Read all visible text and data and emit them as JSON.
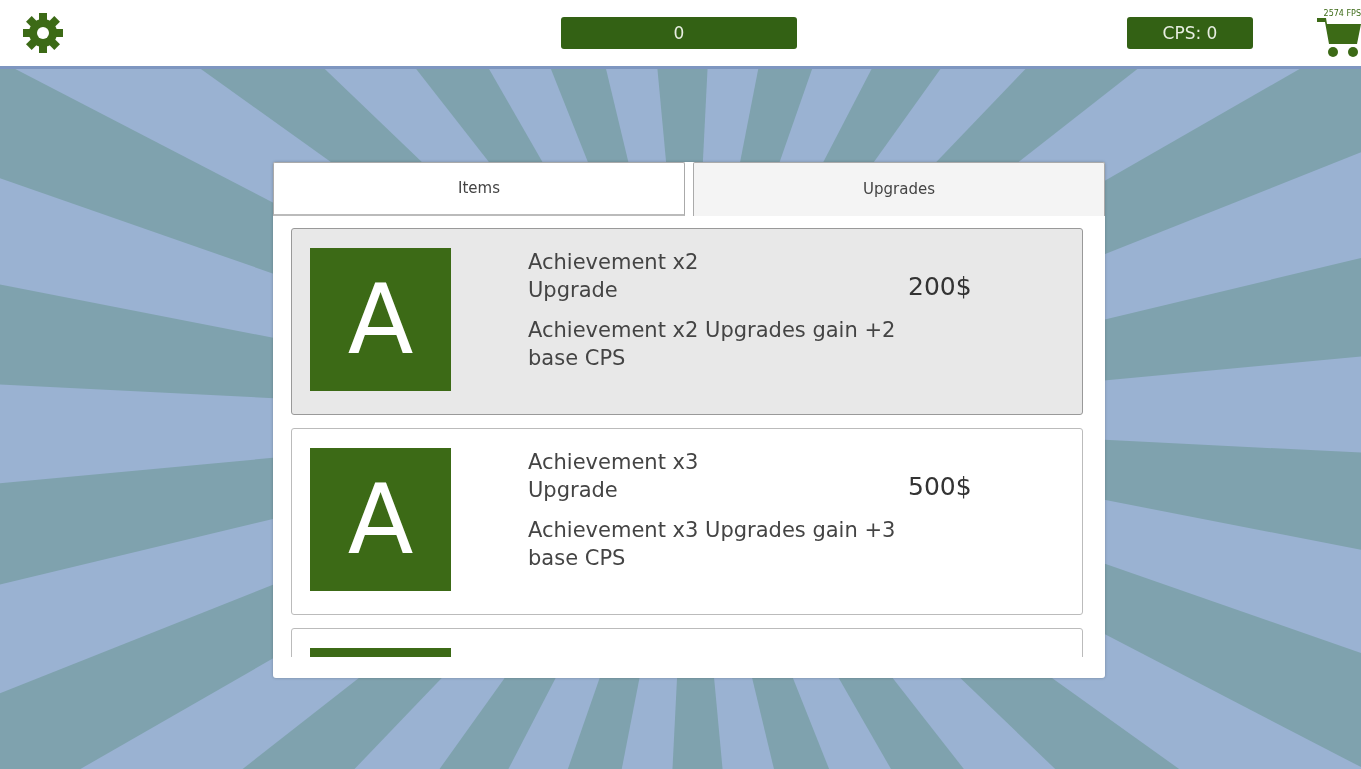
{
  "top_bar": {
    "score": "0",
    "cps": "CPS: 0",
    "fps": "2574 FPS"
  },
  "tabs": [
    {
      "label": "Items",
      "selected": false
    },
    {
      "label": "Upgrades",
      "selected": true
    }
  ],
  "upgrades": [
    {
      "kind": "full",
      "icon_letter": "A",
      "title": "Achievement x2 Upgrade",
      "price": "200$",
      "description": "Achievement x2 Upgrades gain +2 base CPS",
      "highlighted": true
    },
    {
      "kind": "full",
      "icon_letter": "A",
      "title": "Achievement x3 Upgrade",
      "price": "500$",
      "description": "Achievement x3 Upgrades gain +3 base CPS",
      "highlighted": false
    },
    {
      "kind": "partial",
      "highlighted": false
    }
  ]
}
